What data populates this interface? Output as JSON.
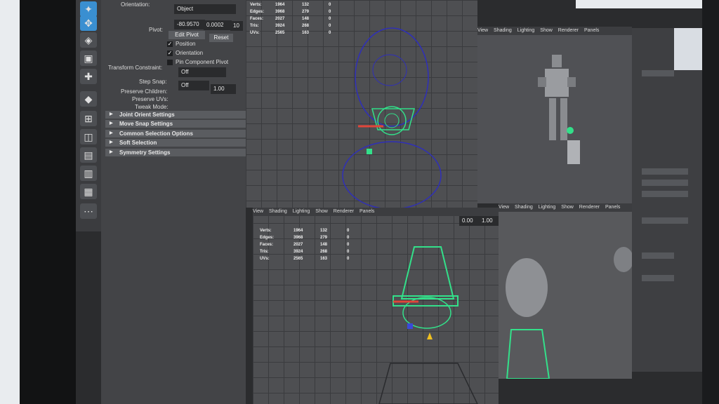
{
  "attribute_editor": {
    "orientation_label": "Orientation:",
    "orientation_value": "Object",
    "pivot_label": "Pivot:",
    "pivot_x": "-80.9570",
    "pivot_y": "0.0002",
    "pivot_z": "10",
    "edit_pivot_label": "Edit Pivot",
    "reset_label": "Reset",
    "position_label": "Position",
    "orientation_check_label": "Orientation",
    "pin_pivot_label": "Pin Component Pivot",
    "transform_constraint_label": "Transform Constraint:",
    "transform_constraint_value": "Off",
    "step_snap_label": "Step Snap:",
    "step_snap_value": "Off",
    "step_snap_amount": "1.00",
    "preserve_children_label": "Preserve Children:",
    "preserve_uvs_label": "Preserve UVs:",
    "tweak_mode_label": "Tweak Mode:",
    "sections": [
      "Joint Orient Settings",
      "Move Snap Settings",
      "Common Selection Options",
      "Soft Selection",
      "Symmetry Settings"
    ]
  },
  "viewport_menu": [
    "View",
    "Shading",
    "Lighting",
    "Show",
    "Renderer",
    "Panels"
  ],
  "hud": {
    "labels": [
      "Verts:",
      "Edges:",
      "Faces:",
      "Tris:",
      "UVs:"
    ],
    "col1": [
      "1964",
      "3968",
      "2027",
      "3924",
      "2565"
    ],
    "col2": [
      "132",
      "279",
      "148",
      "268",
      "163"
    ],
    "col3": [
      "0",
      "0",
      "0",
      "0",
      "0"
    ]
  },
  "viewport_values": {
    "exposure": "0.00",
    "gamma": "1.00"
  },
  "colors": {
    "accent": "#3a8fd1",
    "wire_blue": "#2f2fb8",
    "wire_green": "#33e08a",
    "manip_red": "#e0463a"
  }
}
